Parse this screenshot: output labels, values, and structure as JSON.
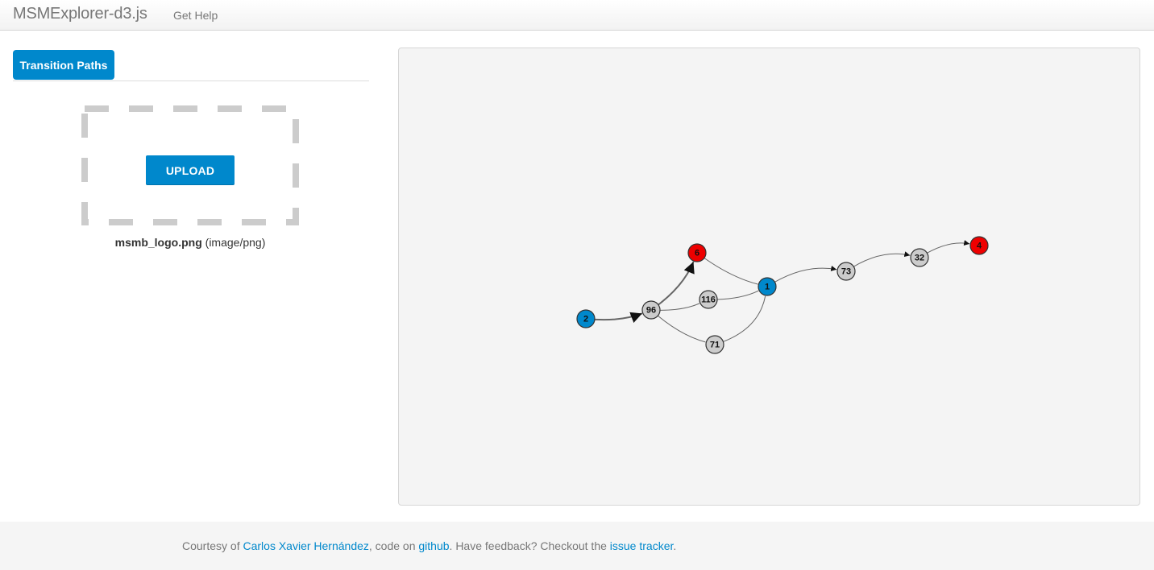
{
  "navbar": {
    "brand": "MSMExplorer-d3.js",
    "help_link": "Get Help"
  },
  "tabs": [
    {
      "label": "Transition Paths",
      "active": true
    }
  ],
  "upload": {
    "button_label": "UPLOAD",
    "file_name": "msmb_logo.png",
    "file_type": "(image/png)"
  },
  "graph": {
    "colors": {
      "source": "#0088cc",
      "sink": "#ee0000",
      "intermediate": "#cccccc",
      "edge": "#666666"
    },
    "nodes": [
      {
        "id": "2",
        "kind": "source"
      },
      {
        "id": "96",
        "kind": "intermediate"
      },
      {
        "id": "6",
        "kind": "sink"
      },
      {
        "id": "116",
        "kind": "intermediate"
      },
      {
        "id": "71",
        "kind": "intermediate"
      },
      {
        "id": "1",
        "kind": "source"
      },
      {
        "id": "73",
        "kind": "intermediate"
      },
      {
        "id": "32",
        "kind": "intermediate"
      },
      {
        "id": "4",
        "kind": "sink"
      }
    ],
    "edges": [
      {
        "from": "2",
        "to": "96",
        "arrow": true,
        "weight": "heavy"
      },
      {
        "from": "96",
        "to": "6",
        "arrow": true,
        "weight": "heavy"
      },
      {
        "from": "96",
        "to": "116",
        "arrow": false,
        "weight": "light"
      },
      {
        "from": "96",
        "to": "71",
        "arrow": false,
        "weight": "light"
      },
      {
        "from": "116",
        "to": "1",
        "arrow": false,
        "weight": "light"
      },
      {
        "from": "71",
        "to": "1",
        "arrow": false,
        "weight": "light"
      },
      {
        "from": "6",
        "to": "1",
        "arrow": false,
        "weight": "light"
      },
      {
        "from": "1",
        "to": "73",
        "arrow": true,
        "weight": "light"
      },
      {
        "from": "73",
        "to": "32",
        "arrow": true,
        "weight": "light"
      },
      {
        "from": "32",
        "to": "4",
        "arrow": true,
        "weight": "light"
      }
    ]
  },
  "footer": {
    "prefix": "Courtesy of ",
    "author": "Carlos Xavier Hernández",
    "mid1": ", code on ",
    "github": "github",
    "mid2": ". Have feedback? Checkout the ",
    "tracker": "issue tracker",
    "suffix": "."
  }
}
